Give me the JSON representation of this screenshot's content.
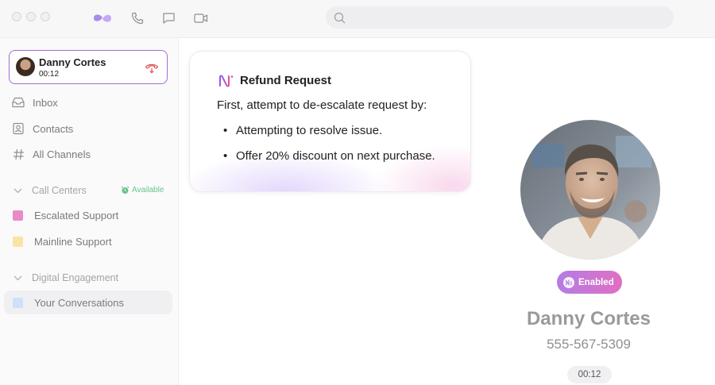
{
  "titlebar": {
    "icons": [
      "app-logo-icon",
      "phone-icon",
      "chat-icon",
      "video-icon"
    ],
    "search_placeholder": ""
  },
  "active_call": {
    "name": "Danny Cortes",
    "duration": "00:12"
  },
  "nav": {
    "inbox": "Inbox",
    "contacts": "Contacts",
    "all_channels": "All Channels"
  },
  "call_centers": {
    "title": "Call Centers",
    "status": "Available",
    "items": [
      {
        "label": "Escalated Support",
        "color": "#e98ac7"
      },
      {
        "label": "Mainline Support",
        "color": "#fbe3a8"
      }
    ]
  },
  "digital_engagement": {
    "title": "Digital Engagement",
    "items": [
      {
        "label": "Your Conversations",
        "color": "#cfe0fb"
      }
    ]
  },
  "refund_card": {
    "title": "Refund Request",
    "intro": "First, attempt to de-escalate request by:",
    "bullets": [
      "Attempting to resolve issue.",
      "Offer 20% discount on next purchase."
    ]
  },
  "caller": {
    "badge": "Enabled",
    "name": "Danny Cortes",
    "phone": "555-567-5309",
    "timer": "00:12"
  },
  "colors": {
    "accent": "#a26bd6",
    "hangup": "#d9534f",
    "available": "#69c38b"
  }
}
